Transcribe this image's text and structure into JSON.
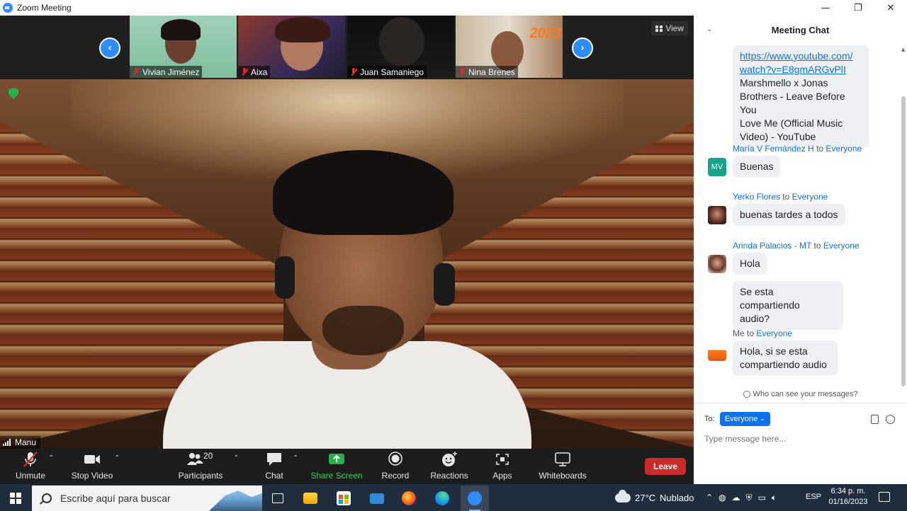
{
  "window": {
    "title": "Zoom Meeting",
    "controls": {
      "minimize": "—",
      "restore": "❐",
      "close": "✕"
    }
  },
  "gallery": {
    "view_label": "View",
    "participants": [
      {
        "name": "Vivian Jiménez",
        "muted": true
      },
      {
        "name": "Aixa",
        "muted": true
      },
      {
        "name": "Juan Samaniego",
        "muted": true
      },
      {
        "name": "Nina Brenes",
        "muted": true
      }
    ],
    "thumb_overlay_text": "2023"
  },
  "main_video": {
    "speaker_name": "Manu"
  },
  "toolbar": {
    "unmute": "Unmute",
    "stop_video": "Stop Video",
    "participants": "Participants",
    "participants_count": "20",
    "chat": "Chat",
    "share_screen": "Share Screen",
    "record": "Record",
    "reactions": "Reactions",
    "apps": "Apps",
    "whiteboards": "Whiteboards",
    "leave": "Leave"
  },
  "chat": {
    "title": "Meeting Chat",
    "first_message": {
      "link_line1": "https://www.youtube.com/",
      "link_line2": "watch?v=E8gmARGvPlI",
      "text_lines": [
        "Marshmello x Jonas",
        "Brothers - Leave Before You",
        "Love Me (Official Music",
        "Video) - YouTube"
      ]
    },
    "messages": [
      {
        "sender": "María V Fernández H",
        "to_word": "to",
        "to": "Everyone",
        "avatar_initials": "MV",
        "texts": [
          "Buenas"
        ]
      },
      {
        "sender": "Yerko Flores",
        "to_word": "to",
        "to": "Everyone",
        "texts": [
          "buenas tardes a todos"
        ]
      },
      {
        "sender": "Arinda Palacios - MT",
        "to_word": "to",
        "to": "Everyone",
        "texts": [
          "Hola"
        ]
      },
      {
        "extra_lines": [
          "Se esta compartiendo",
          "audio?"
        ]
      },
      {
        "sender": "Me",
        "to_word": "to",
        "to": "Everyone",
        "texts_lines": [
          "Hola, si se esta",
          "compartiendo audio"
        ]
      }
    ],
    "who_can_see": "Who can see your messages?",
    "to_label": "To:",
    "recipient": "Everyone",
    "input_placeholder": "Type message here..."
  },
  "taskbar": {
    "search_placeholder": "Escribe aquí para buscar",
    "weather_temp": "27°C",
    "weather_desc": "Nublado",
    "language": "ESP",
    "time": "6:34 p. m.",
    "date": "01/16/2023"
  },
  "colors": {
    "accent": "#0e72ed",
    "leave": "#cc2b2b",
    "share": "#26b24a",
    "taskbar": "#202d3f"
  }
}
